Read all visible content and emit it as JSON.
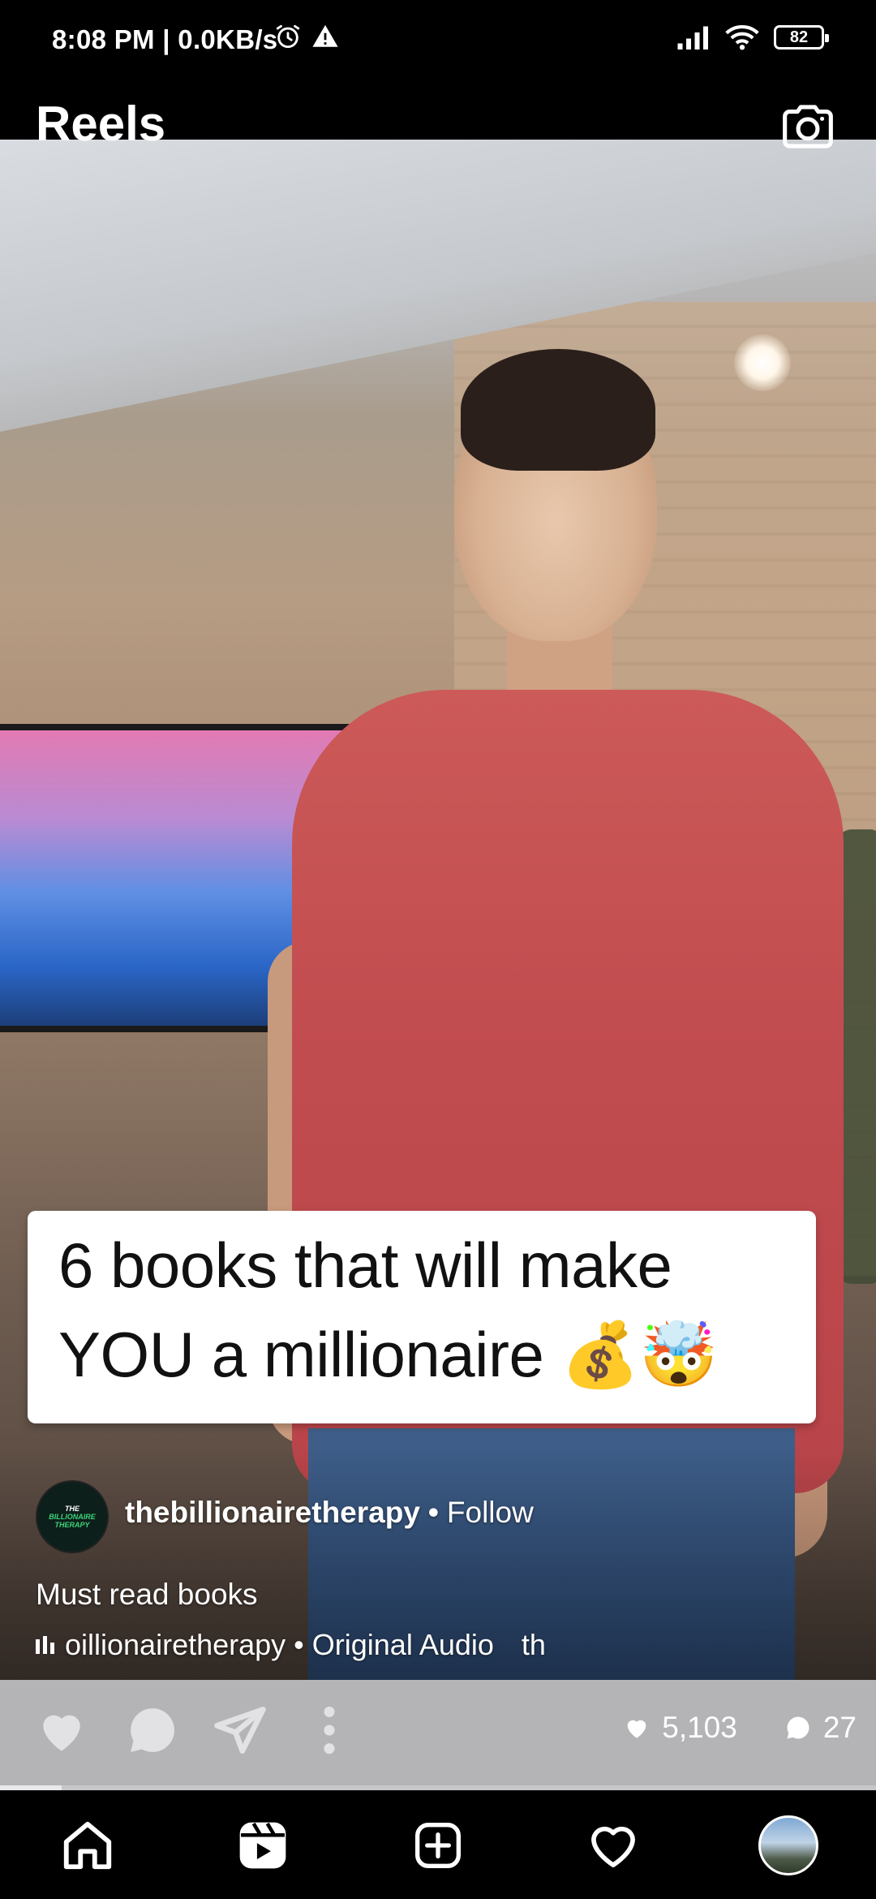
{
  "status_bar": {
    "time": "8:08 PM | 0.0KB/s",
    "battery": "82",
    "icons": [
      "alarm-icon",
      "warning-icon",
      "signal-icon",
      "wifi-icon",
      "battery-icon"
    ]
  },
  "header": {
    "title": "Reels",
    "camera_icon": "camera-icon"
  },
  "video": {
    "caption_line1": "6 books that will make",
    "caption_line2": "YOU a millionaire 💰🤯"
  },
  "creator": {
    "avatar_text": [
      "THE",
      "BILLIONAIRE",
      "THERAPY"
    ],
    "username": "thebillionairetherapy",
    "separator": "•",
    "follow_label": "Follow"
  },
  "reel": {
    "caption": "Must read books",
    "audio_text": "oillionairetherapy • Original Audio",
    "audio_text_extra": "th"
  },
  "actions": {
    "likes": "5,103",
    "comments": "27",
    "icons": [
      "heart-icon",
      "comment-icon",
      "share-icon",
      "more-icon"
    ]
  },
  "progress": {
    "fraction": 0.07
  },
  "bottom_nav": {
    "items": [
      "home-icon",
      "reels-icon",
      "create-icon",
      "activity-icon",
      "profile-avatar"
    ]
  }
}
